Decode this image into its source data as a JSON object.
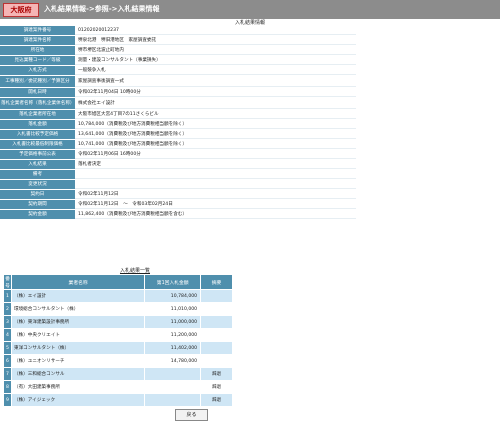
{
  "header": {
    "badge": "大阪府",
    "title": "入札結果情報->参照->入札結果情報"
  },
  "detail": {
    "caption": "入札結果情報",
    "rows": [
      {
        "label": "調達案件番号",
        "value": "01202020012237"
      },
      {
        "label": "調達案件名称",
        "value": "堺泉北港　堺旧港地区　家屋調査委託"
      },
      {
        "label": "所在地",
        "value": "堺市堺区北波止町地内"
      },
      {
        "label": "見込業種コード／等級",
        "value": "測量・建設コンサルタント（事業損失）"
      },
      {
        "label": "入札方式",
        "value": "一般競争入札"
      },
      {
        "label": "工事種別／委託種別／予算区分",
        "value": "家屋調査事後調査一式"
      },
      {
        "label": "開札日時",
        "value": "令和02年11月04日 10時00分"
      },
      {
        "label": "落札企業者名称（落札企業体名称）",
        "value": "株式会社エイ設計"
      },
      {
        "label": "落札企業者所在地",
        "value": "大阪市旭区大宮4丁目7の11さくらビル"
      },
      {
        "label": "落札金額",
        "value": "10,784,000（消費税及び地方消費税相当額を除く）"
      },
      {
        "label": "入札書比較予定価格",
        "value": "13,641,000（消費税及び地方消費税相当額を除く）"
      },
      {
        "label": "入札書比較最低制限価格",
        "value": "10,741,000（消費税及び地方消費税相当額を除く）"
      },
      {
        "label": "予定価格事前公表",
        "value": "令和02年11月06日 16時00分"
      },
      {
        "label": "入札結果",
        "value": "落札者決定"
      },
      {
        "label": "備考",
        "value": ""
      },
      {
        "label": "変更状況",
        "value": ""
      },
      {
        "label": "契約日",
        "value": "令和02年11月12日"
      },
      {
        "label": "契約期間",
        "value": "令和02年11月12日　～　令和03年02月24日"
      },
      {
        "label": "契約金額",
        "value": "11,862,400（消費税及び地方消費税相当額を含む）"
      }
    ]
  },
  "results": {
    "caption": "入札結果一覧",
    "headers": [
      "番号",
      "業者名称",
      "第1回入札金額",
      "摘要"
    ],
    "rows": [
      {
        "no": "1",
        "name": "（株）エイ設計",
        "amount": "10,784,000",
        "remark": ""
      },
      {
        "no": "2",
        "name": "環境総合コンサルタント（株）",
        "amount": "11,010,000",
        "remark": ""
      },
      {
        "no": "3",
        "name": "（株）東洋建築設計事務所",
        "amount": "11,000,000",
        "remark": ""
      },
      {
        "no": "4",
        "name": "（株）中央クリエイト",
        "amount": "11,200,000",
        "remark": ""
      },
      {
        "no": "5",
        "name": "東洋コンサルタント（株）",
        "amount": "11,402,000",
        "remark": ""
      },
      {
        "no": "6",
        "name": "（株）ユニオンリサーチ",
        "amount": "14,780,000",
        "remark": ""
      },
      {
        "no": "7",
        "name": "（株）三和総合コンサル",
        "amount": "",
        "remark": "辞退"
      },
      {
        "no": "8",
        "name": "（有）大田建築事務所",
        "amount": "",
        "remark": "辞退"
      },
      {
        "no": "9",
        "name": "（株）アイジェック",
        "amount": "",
        "remark": "辞退"
      }
    ]
  },
  "buttons": {
    "back": "戻る"
  }
}
